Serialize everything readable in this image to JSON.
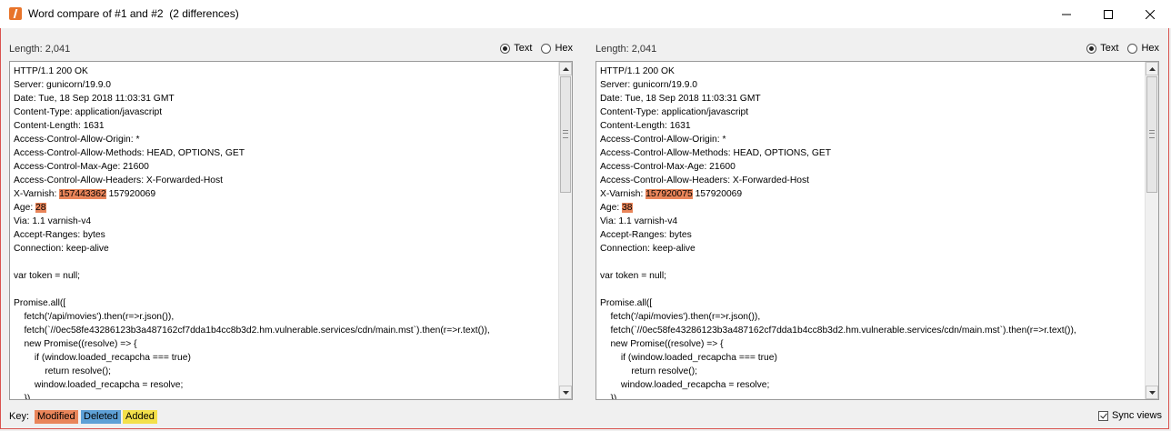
{
  "window": {
    "title": "Word compare of #1 and #2  (2 differences)",
    "accent_color": "#e8742a"
  },
  "left": {
    "length": "Length: 2,041",
    "radio_text": "Text",
    "radio_hex": "Hex",
    "selected": "Text",
    "lines": [
      [
        {
          "t": "HTTP/1.1 200 OK"
        }
      ],
      [
        {
          "t": "Server: gunicorn/19.9.0"
        }
      ],
      [
        {
          "t": "Date: Tue, 18 Sep 2018 11:03:31 GMT"
        }
      ],
      [
        {
          "t": "Content-Type: application/javascript"
        }
      ],
      [
        {
          "t": "Content-Length: 1631"
        }
      ],
      [
        {
          "t": "Access-Control-Allow-Origin: *"
        }
      ],
      [
        {
          "t": "Access-Control-Allow-Methods: HEAD, OPTIONS, GET"
        }
      ],
      [
        {
          "t": "Access-Control-Max-Age: 21600"
        }
      ],
      [
        {
          "t": "Access-Control-Allow-Headers: X-Forwarded-Host"
        }
      ],
      [
        {
          "t": "X-Varnish: "
        },
        {
          "t": "157443362",
          "h": "mod"
        },
        {
          "t": " 157920069"
        }
      ],
      [
        {
          "t": "Age: "
        },
        {
          "t": "28",
          "h": "mod"
        }
      ],
      [
        {
          "t": "Via: 1.1 varnish-v4"
        }
      ],
      [
        {
          "t": "Accept-Ranges: bytes"
        }
      ],
      [
        {
          "t": "Connection: keep-alive"
        }
      ],
      [
        {
          "t": ""
        }
      ],
      [
        {
          "t": "var token = null;"
        }
      ],
      [
        {
          "t": ""
        }
      ],
      [
        {
          "t": "Promise.all(["
        }
      ],
      [
        {
          "t": "    fetch('/api/movies').then(r=>r.json()),"
        }
      ],
      [
        {
          "t": "    fetch(`//0ec58fe43286123b3a487162cf7dda1b4cc8b3d2.hm.vulnerable.services/cdn/main.mst`).then(r=>r.text()),"
        }
      ],
      [
        {
          "t": "    new Promise((resolve) => {"
        }
      ],
      [
        {
          "t": "        if (window.loaded_recapcha === true)"
        }
      ],
      [
        {
          "t": "            return resolve();"
        }
      ],
      [
        {
          "t": "        window.loaded_recapcha = resolve;"
        }
      ],
      [
        {
          "t": "    }),"
        }
      ]
    ]
  },
  "right": {
    "length": "Length: 2,041",
    "radio_text": "Text",
    "radio_hex": "Hex",
    "selected": "Text",
    "lines": [
      [
        {
          "t": "HTTP/1.1 200 OK"
        }
      ],
      [
        {
          "t": "Server: gunicorn/19.9.0"
        }
      ],
      [
        {
          "t": "Date: Tue, 18 Sep 2018 11:03:31 GMT"
        }
      ],
      [
        {
          "t": "Content-Type: application/javascript"
        }
      ],
      [
        {
          "t": "Content-Length: 1631"
        }
      ],
      [
        {
          "t": "Access-Control-Allow-Origin: *"
        }
      ],
      [
        {
          "t": "Access-Control-Allow-Methods: HEAD, OPTIONS, GET"
        }
      ],
      [
        {
          "t": "Access-Control-Max-Age: 21600"
        }
      ],
      [
        {
          "t": "Access-Control-Allow-Headers: X-Forwarded-Host"
        }
      ],
      [
        {
          "t": "X-Varnish: "
        },
        {
          "t": "157920075",
          "h": "mod"
        },
        {
          "t": " 157920069"
        }
      ],
      [
        {
          "t": "Age: "
        },
        {
          "t": "38",
          "h": "mod"
        }
      ],
      [
        {
          "t": "Via: 1.1 varnish-v4"
        }
      ],
      [
        {
          "t": "Accept-Ranges: bytes"
        }
      ],
      [
        {
          "t": "Connection: keep-alive"
        }
      ],
      [
        {
          "t": ""
        }
      ],
      [
        {
          "t": "var token = null;"
        }
      ],
      [
        {
          "t": ""
        }
      ],
      [
        {
          "t": "Promise.all(["
        }
      ],
      [
        {
          "t": "    fetch('/api/movies').then(r=>r.json()),"
        }
      ],
      [
        {
          "t": "    fetch(`//0ec58fe43286123b3a487162cf7dda1b4cc8b3d2.hm.vulnerable.services/cdn/main.mst`).then(r=>r.text()),"
        }
      ],
      [
        {
          "t": "    new Promise((resolve) => {"
        }
      ],
      [
        {
          "t": "        if (window.loaded_recapcha === true)"
        }
      ],
      [
        {
          "t": "            return resolve();"
        }
      ],
      [
        {
          "t": "        window.loaded_recapcha = resolve;"
        }
      ],
      [
        {
          "t": "    }),"
        }
      ]
    ]
  },
  "key": {
    "label": "Key:",
    "modified": "Modified",
    "deleted": "Deleted",
    "added": "Added",
    "colors": {
      "modified": "#e9855a",
      "deleted": "#5ea0d6",
      "added": "#f3e04a"
    }
  },
  "sync": {
    "label": "Sync views",
    "checked": true
  },
  "icons": {
    "app": "burp-icon",
    "minimize": "minimize-icon",
    "maximize": "maximize-icon",
    "close": "close-icon"
  }
}
